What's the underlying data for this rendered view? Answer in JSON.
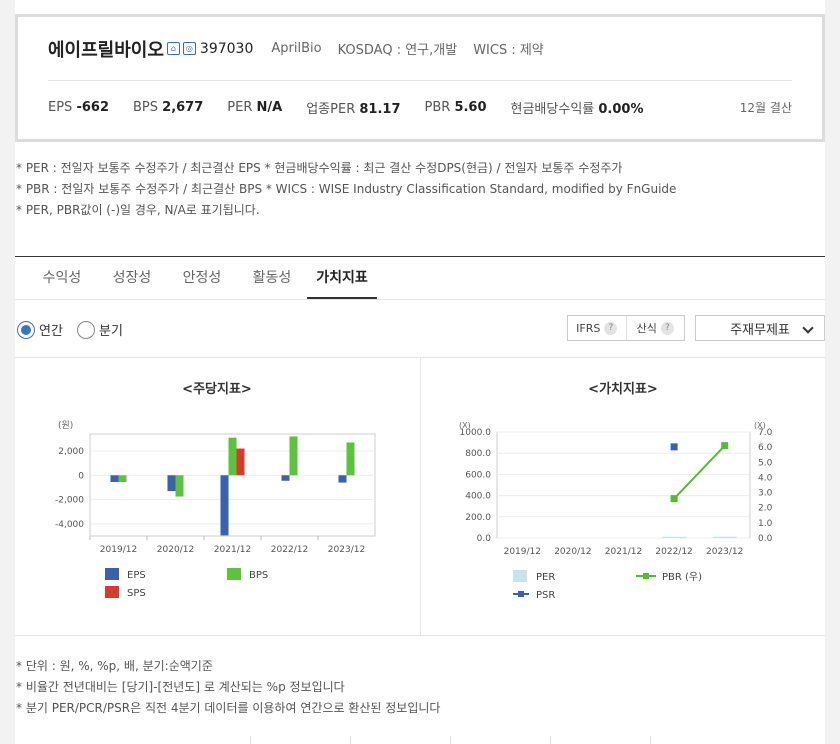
{
  "company": {
    "name": "에이프릴바이오",
    "icon1": "home-icon",
    "icon1_glyph": "⌂",
    "icon2": "chart-icon",
    "icon2_glyph": "◎",
    "code": "397030",
    "english_name": "AprilBio",
    "market": "KOSDAQ : 연구,개발",
    "wics": "WICS : 제약"
  },
  "stats": {
    "eps_label": "EPS",
    "eps": "-662",
    "bps_label": "BPS",
    "bps": "2,677",
    "per_label": "PER",
    "per": "N/A",
    "ind_per_label": "업종PER",
    "ind_per": "81.17",
    "pbr_label": "PBR",
    "pbr": "5.60",
    "div_label": "현금배당수익률",
    "div": "0.00%",
    "settlement": "12월 결산"
  },
  "notes_top": [
    "* PER : 전일자 보통주 수정주가 / 최근결산 EPS * 현금배당수익률 : 최근 결산 수정DPS(현금) / 전일자 보통주 수정주가",
    "* PBR : 전일자 보통주 수정주가 / 최근결산 BPS * WICS : WISE Industry Classification Standard, modified by FnGuide",
    "* PER, PBR값이 (-)일 경우, N/A로 표기됩니다."
  ],
  "tabs": [
    "수익성",
    "성장성",
    "안정성",
    "활동성",
    "가치지표"
  ],
  "options": {
    "annual": "연간",
    "quarter": "분기",
    "ifrs": "IFRS",
    "calc": "산식",
    "help_glyph": "?",
    "select_value": "주재무제표"
  },
  "colors": {
    "eps": "#3a62ac",
    "bps": "#5cc43c",
    "sps": "#d43c2c",
    "per": "#c7e3ee",
    "pbr": "#55bb33",
    "psr": "#3a62ac"
  },
  "chart_data": [
    {
      "type": "bar",
      "title": "<주당지표>",
      "ylabel": "(원)",
      "categories": [
        "2019/12",
        "2020/12",
        "2021/12",
        "2022/12",
        "2023/12"
      ],
      "yticks": [
        "2,000",
        "0",
        "-2,000",
        "-4,000"
      ],
      "ylim": [
        -5000,
        3400
      ],
      "legend": [
        "EPS",
        "BPS",
        "SPS"
      ],
      "series": [
        {
          "name": "EPS",
          "values": [
            -550,
            -1300,
            -4950,
            -450,
            -600
          ]
        },
        {
          "name": "BPS",
          "values": [
            -550,
            -1750,
            3100,
            3200,
            2700
          ]
        },
        {
          "name": "SPS",
          "values": [
            null,
            null,
            2200,
            null,
            null
          ]
        }
      ]
    },
    {
      "type": "bar",
      "title": "<가치지표>",
      "ylabel_left": "(X)",
      "ylabel_right": "(X)",
      "categories": [
        "2019/12",
        "2020/12",
        "2021/12",
        "2022/12",
        "2023/12"
      ],
      "yticks_left": [
        "1000.0",
        "800.0",
        "600.0",
        "400.0",
        "200.0",
        "0.0"
      ],
      "yticks_right": [
        "7.0",
        "6.0",
        "5.0",
        "4.0",
        "3.0",
        "2.0",
        "1.0",
        "0.0"
      ],
      "ylim_left": [
        0,
        1000
      ],
      "ylim_right": [
        0,
        7
      ],
      "legend": [
        "PER",
        "PBR (우)",
        "PSR"
      ],
      "series": [
        {
          "name": "PER",
          "values": [
            null,
            null,
            null,
            12,
            12
          ]
        },
        {
          "name": "PBR (우)",
          "values": [
            null,
            null,
            null,
            2.6,
            6.1
          ]
        },
        {
          "name": "PSR",
          "values": [
            null,
            null,
            null,
            860,
            null
          ]
        }
      ]
    }
  ],
  "notes_bottom": [
    "* 단위 : 원, %, %p, 배, 분기:순액기준",
    "* 비율간 전년대비는 [당기]-[전년도] 로 계산되는 %p 정보입니다",
    "* 분기 PER/PCR/PSR은 직전 4분기 데이터를 이용하여 연간으로 환산된 정보입니다"
  ]
}
